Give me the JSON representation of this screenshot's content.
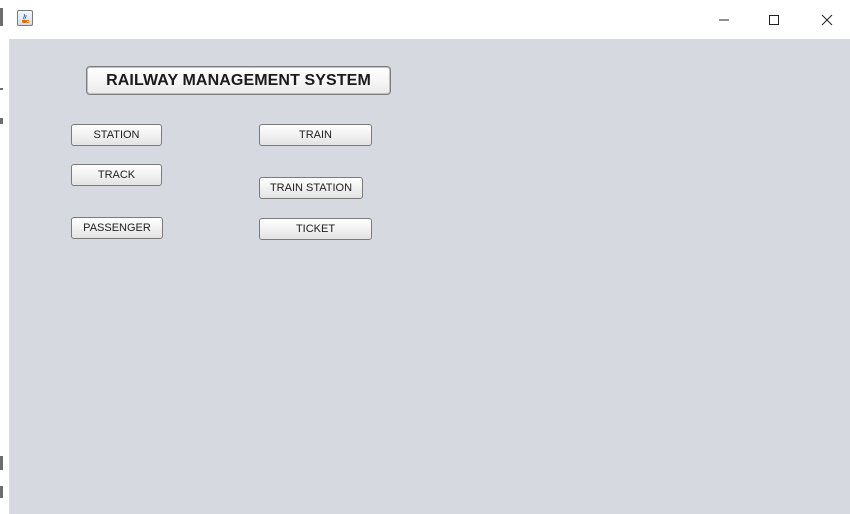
{
  "window": {
    "icon": "java-coffee-cup-icon",
    "controls": {
      "minimize_icon": "minimize-icon",
      "maximize_icon": "maximize-icon",
      "close_icon": "close-icon"
    }
  },
  "main": {
    "title": "RAILWAY MANAGEMENT SYSTEM",
    "buttons": {
      "station": "STATION",
      "train": "TRAIN",
      "track": "TRACK",
      "train_station": "TRAIN STATION",
      "passenger": "PASSENGER",
      "ticket": "TICKET"
    }
  },
  "colors": {
    "panel_background": "#d6d9e0",
    "titlebar_background": "#ffffff",
    "title_focus_border": "#a9c4e4"
  }
}
